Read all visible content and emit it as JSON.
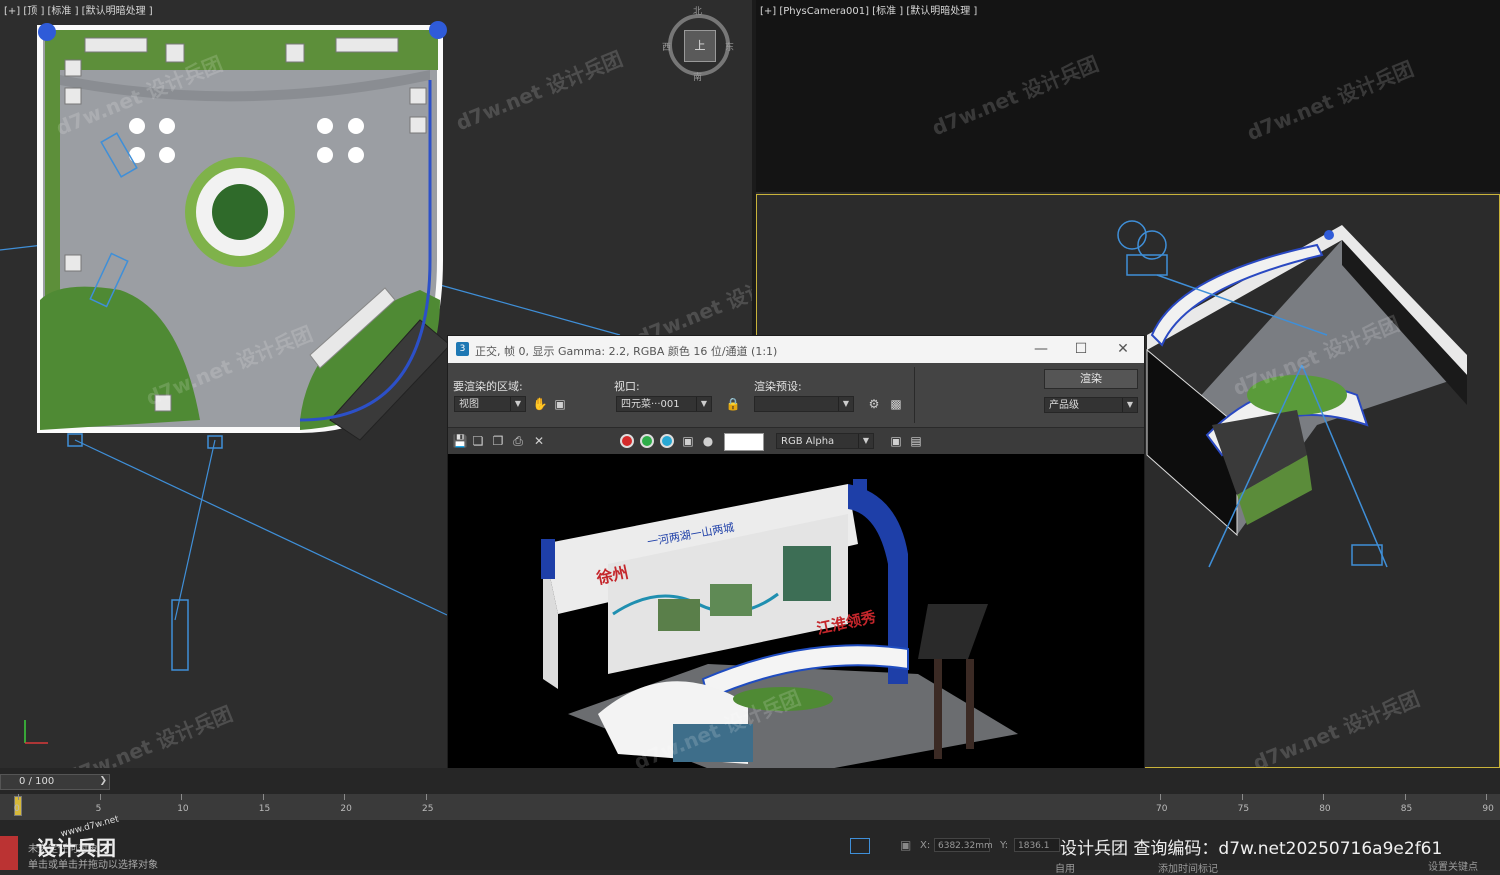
{
  "viewports": {
    "top": {
      "label": "[+] [顶 ] [标准 ] [默认明暗处理 ]"
    },
    "camera": {
      "label": "[+] [PhysCamera001] [标准 ] [默认明暗处理 ]"
    },
    "viewcube": {
      "north": "北",
      "south": "南",
      "west": "西",
      "east": "东",
      "face": "上"
    }
  },
  "watermark": {
    "text": "d7w.net 设计兵团"
  },
  "booth": {
    "header_text": "一河两湖一山两城",
    "city_text": "徐州",
    "slogan_text": "江淮领秀"
  },
  "render_frame": {
    "title": "正交, 帧 0, 显示 Gamma: 2.2, RGBA 颜色 16 位/通道 (1:1)",
    "app_icon": "3",
    "area_label": "要渲染的区域:",
    "area_value": "视图",
    "viewport_label": "视口:",
    "viewport_value": "四元菜···001",
    "preset_label": "渲染预设:",
    "preset_value": "",
    "render_button": "渲染",
    "quality_value": "产品级",
    "channel_value": "RGB Alpha",
    "colors": {
      "red": "#d42a2a",
      "green": "#2fae4a",
      "cyan": "#28a8d4"
    }
  },
  "timeline": {
    "frame_counter": "0 / 100",
    "ticks_left": [
      "0",
      "5",
      "10",
      "15",
      "20",
      "25"
    ],
    "ticks_right": [
      "70",
      "75",
      "80",
      "85",
      "90"
    ]
  },
  "status": {
    "x_label": "X:",
    "x_value": "6382.32mm",
    "y_label": "Y:",
    "y_value": "1836.1",
    "logo_site": "www.d7w.net",
    "logo_text": "设计兵团",
    "query_code": "设计兵团  查询编码：d7w.net20250716a9e2f61",
    "left_text_1": "未选定任何对象",
    "left_text_2": "单击或单击并拖动以选择对象",
    "auto": "自用",
    "add_key": "添加时间标记",
    "set_key": "设置关键点"
  }
}
